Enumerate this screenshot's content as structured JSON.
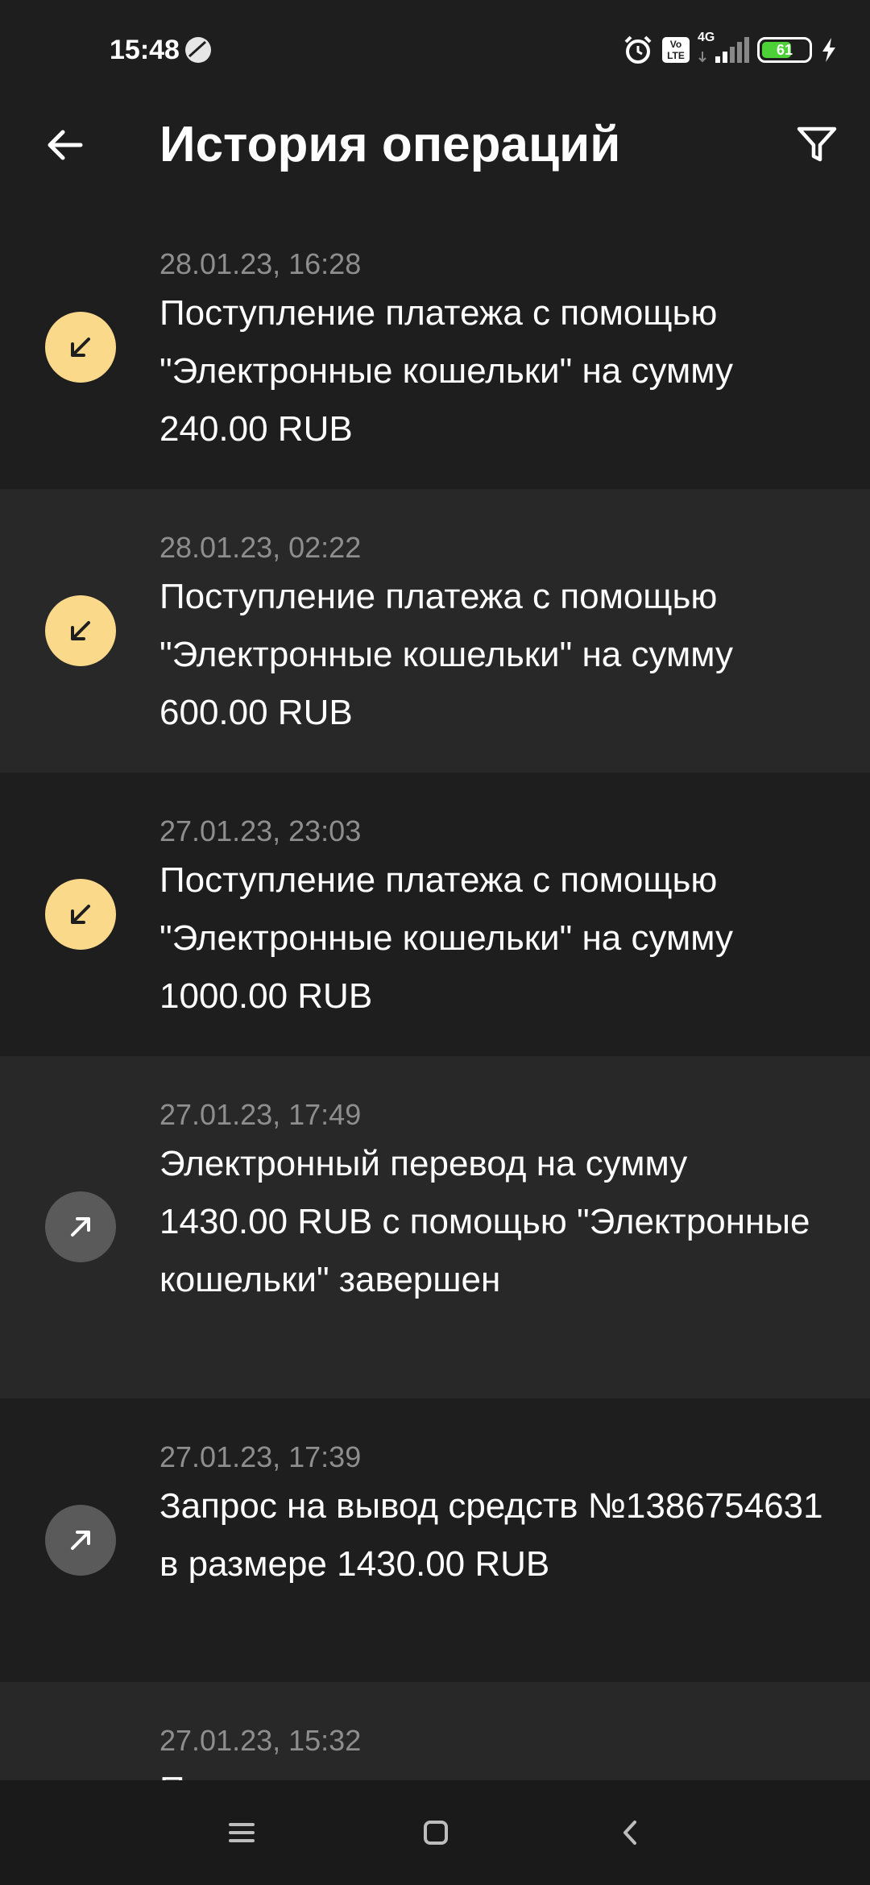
{
  "status_bar": {
    "time": "15:48",
    "network": "4G",
    "volte": "Vo LTE",
    "battery": "61"
  },
  "header": {
    "title": "История операций"
  },
  "transactions": [
    {
      "date": "28.01.23, 16:28",
      "text": "Поступление платежа с помощью \"Электронные кошельки\" на сумму 240.00 RUB",
      "direction": "in",
      "icon": "arrow-down-left-icon"
    },
    {
      "date": "28.01.23, 02:22",
      "text": "Поступление платежа с помощью \"Электронные кошельки\" на сумму 600.00 RUB",
      "direction": "in",
      "icon": "arrow-down-left-icon"
    },
    {
      "date": "27.01.23, 23:03",
      "text": "Поступление платежа с помощью \"Электронные кошельки\" на сумму 1000.00 RUB",
      "direction": "in",
      "icon": "arrow-down-left-icon"
    },
    {
      "date": "27.01.23, 17:49",
      "text": "Электронный перевод на сумму 1430.00 RUB с помощью \"Электронные кошельки\" завершен",
      "direction": "out",
      "icon": "arrow-up-right-icon"
    },
    {
      "date": "27.01.23, 17:39",
      "text": "Запрос на вывод средств №1386754631 в размере 1430.00 RUB",
      "direction": "out",
      "icon": "arrow-up-right-icon"
    },
    {
      "date": "27.01.23, 15:32",
      "text": "Поступление платежа с помощью",
      "direction": "in",
      "icon": "arrow-down-left-icon"
    }
  ],
  "colors": {
    "background": "#1e1e1e",
    "row_alt": "#282828",
    "incoming_icon_bg": "#fbd98b",
    "outgoing_icon_bg": "#5a5a5a",
    "date_text": "#8e8e8e",
    "battery_green": "#4cd137"
  }
}
